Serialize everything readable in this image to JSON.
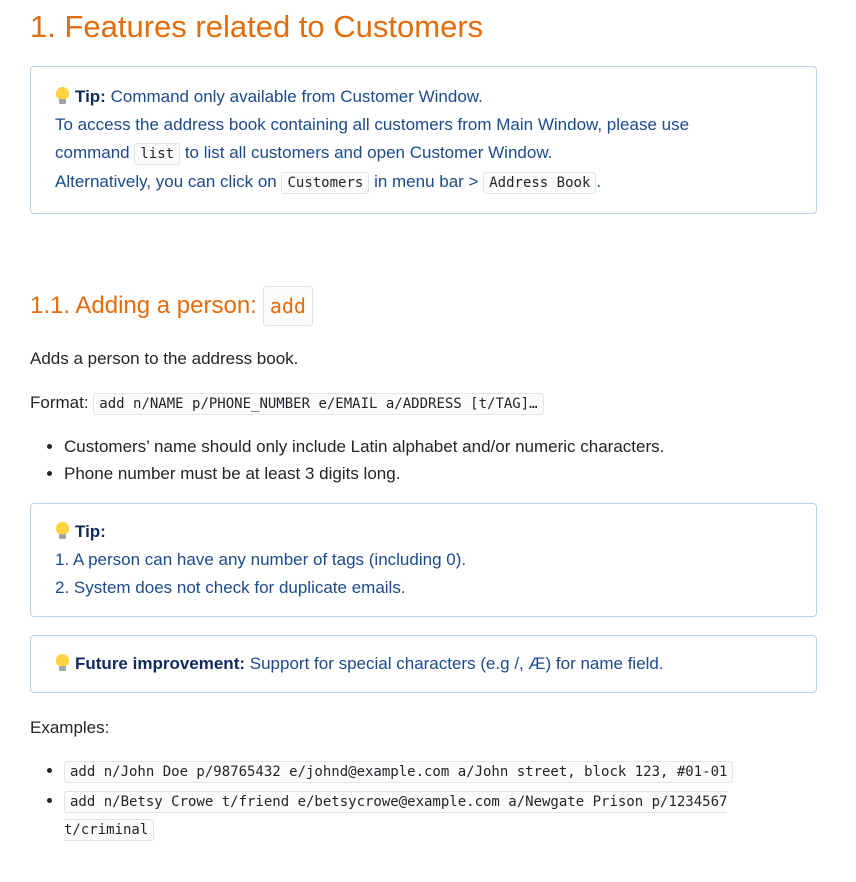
{
  "section_title": "1. Features related to Customers",
  "tip1": {
    "label": "Tip:",
    "line1": "Command only available from Customer Window.",
    "line2": "To access the address book containing all customers from Main Window, please use",
    "line3_pre": "command",
    "line3_code": "list",
    "line3_post": "to list all customers and open Customer Window.",
    "line4_pre": "Alternatively, you can click on",
    "line4_code1": "Customers",
    "line4_mid": "in menu bar >",
    "line4_code2": "Address Book",
    "line4_post": "."
  },
  "subsection": {
    "title": "1.1. Adding a person:",
    "title_code": "add",
    "description": "Adds a person to the address book.",
    "format_label": "Format:",
    "format_code": "add n/NAME p/PHONE_NUMBER e/EMAIL a/ADDRESS [t/TAG]…"
  },
  "constraints": [
    "Customers’ name should only include Latin alphabet and/or numeric characters.",
    "Phone number must be at least 3 digits long."
  ],
  "tip2": {
    "label": "Tip:",
    "items": [
      "1. A person can have any number of tags (including 0).",
      "2. System does not check for duplicate emails."
    ]
  },
  "future": {
    "label": "Future improvement:",
    "text": "Support for special characters (e.g /, Æ) for name field."
  },
  "examples_label": "Examples:",
  "examples": [
    "add n/John Doe p/98765432 e/johnd@example.com a/John street, block 123, #01-01",
    "add n/Betsy Crowe t/friend e/betsycrowe@example.com a/Newgate Prison p/1234567 t/criminal"
  ]
}
